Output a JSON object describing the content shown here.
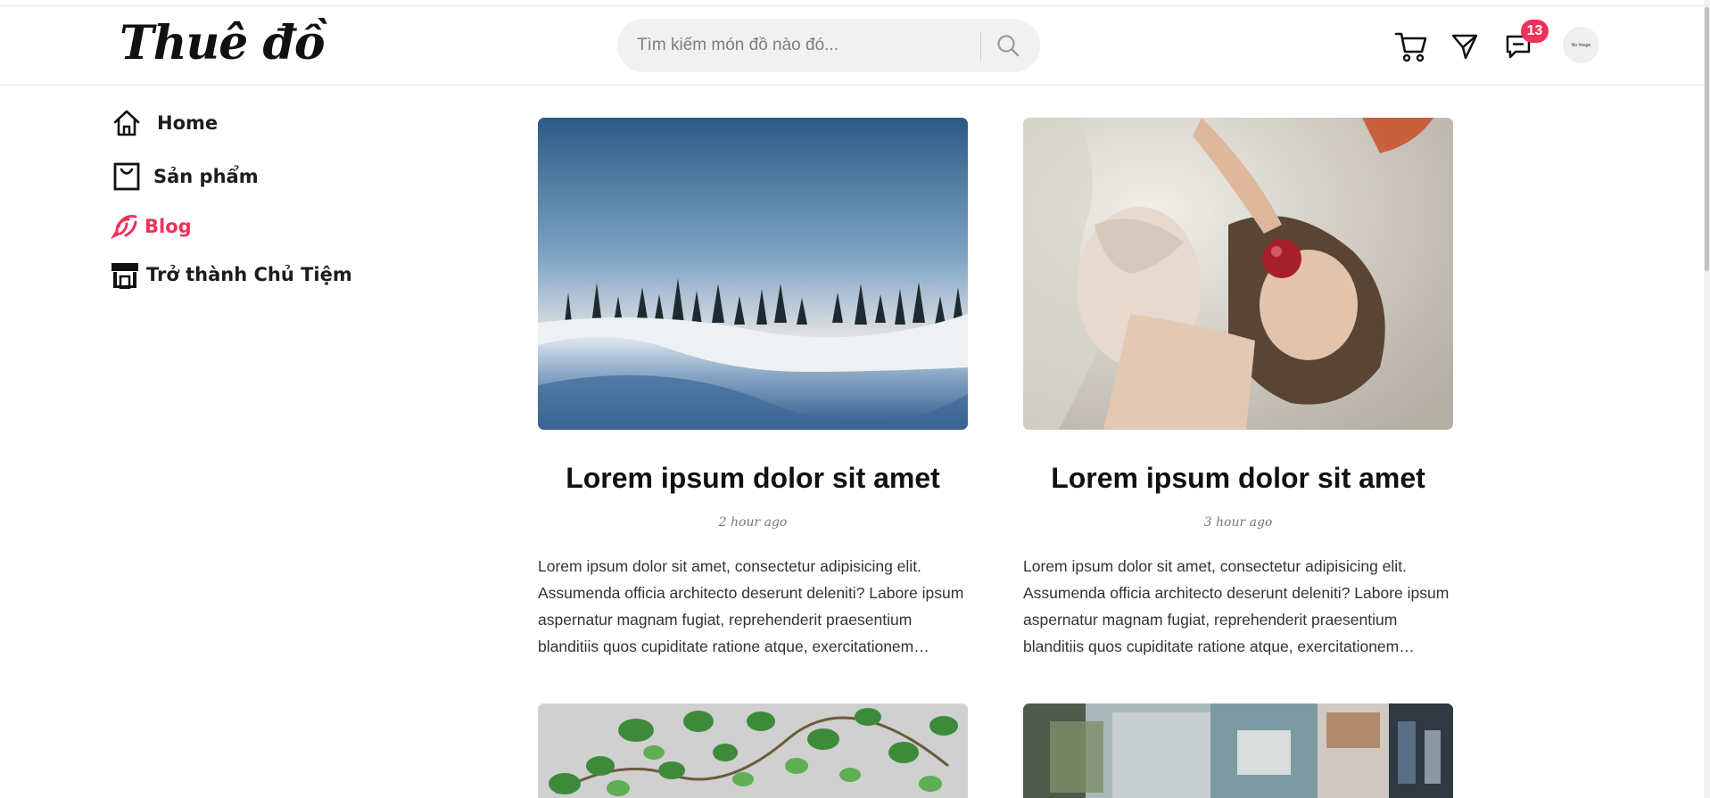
{
  "app": {
    "logo_text": "Thuê đồ"
  },
  "search": {
    "placeholder": "Tìm kiếm món đồ nào đó...",
    "value": "",
    "icon": "search-icon"
  },
  "header": {
    "icons": [
      "cart-icon",
      "send-icon",
      "message-icon"
    ],
    "notification_count": "13",
    "avatar_text": "No Image",
    "accent": "#f2305a"
  },
  "sidebar": {
    "items": [
      {
        "label": "Home",
        "icon": "home-icon",
        "active": false
      },
      {
        "label": "Sản phẩm",
        "icon": "shopping-bag-icon",
        "active": false
      },
      {
        "label": "Blog",
        "icon": "blog-feed-icon",
        "active": true
      },
      {
        "label": "Trở thành Chủ Tiệm",
        "icon": "store-icon",
        "active": false
      }
    ]
  },
  "posts": [
    {
      "title": "Lorem ipsum dolor sit amet",
      "time": "2 hour ago",
      "excerpt": "Lorem ipsum dolor sit amet, consectetur adipisicing elit. Assumenda officia architecto deserunt deleniti? Labore ipsum aspernatur magnam fugiat, reprehenderit praesentium blanditiis quos cupiditate ratione atque, exercitationem…",
      "image": "snowy-forest-landscape"
    },
    {
      "title": "Lorem ipsum dolor sit amet",
      "time": "3 hour ago",
      "excerpt": "Lorem ipsum dolor sit amet, consectetur adipisicing elit. Assumenda officia architecto deserunt deleniti? Labore ipsum aspernatur magnam fugiat, reprehenderit praesentium blanditiis quos cupiditate ratione atque, exercitationem…",
      "image": "woman-with-apple"
    },
    {
      "title": "",
      "time": "",
      "excerpt": "",
      "image": "green-ivy-leaves"
    },
    {
      "title": "",
      "time": "",
      "excerpt": "",
      "image": "blurred-shelves"
    }
  ]
}
